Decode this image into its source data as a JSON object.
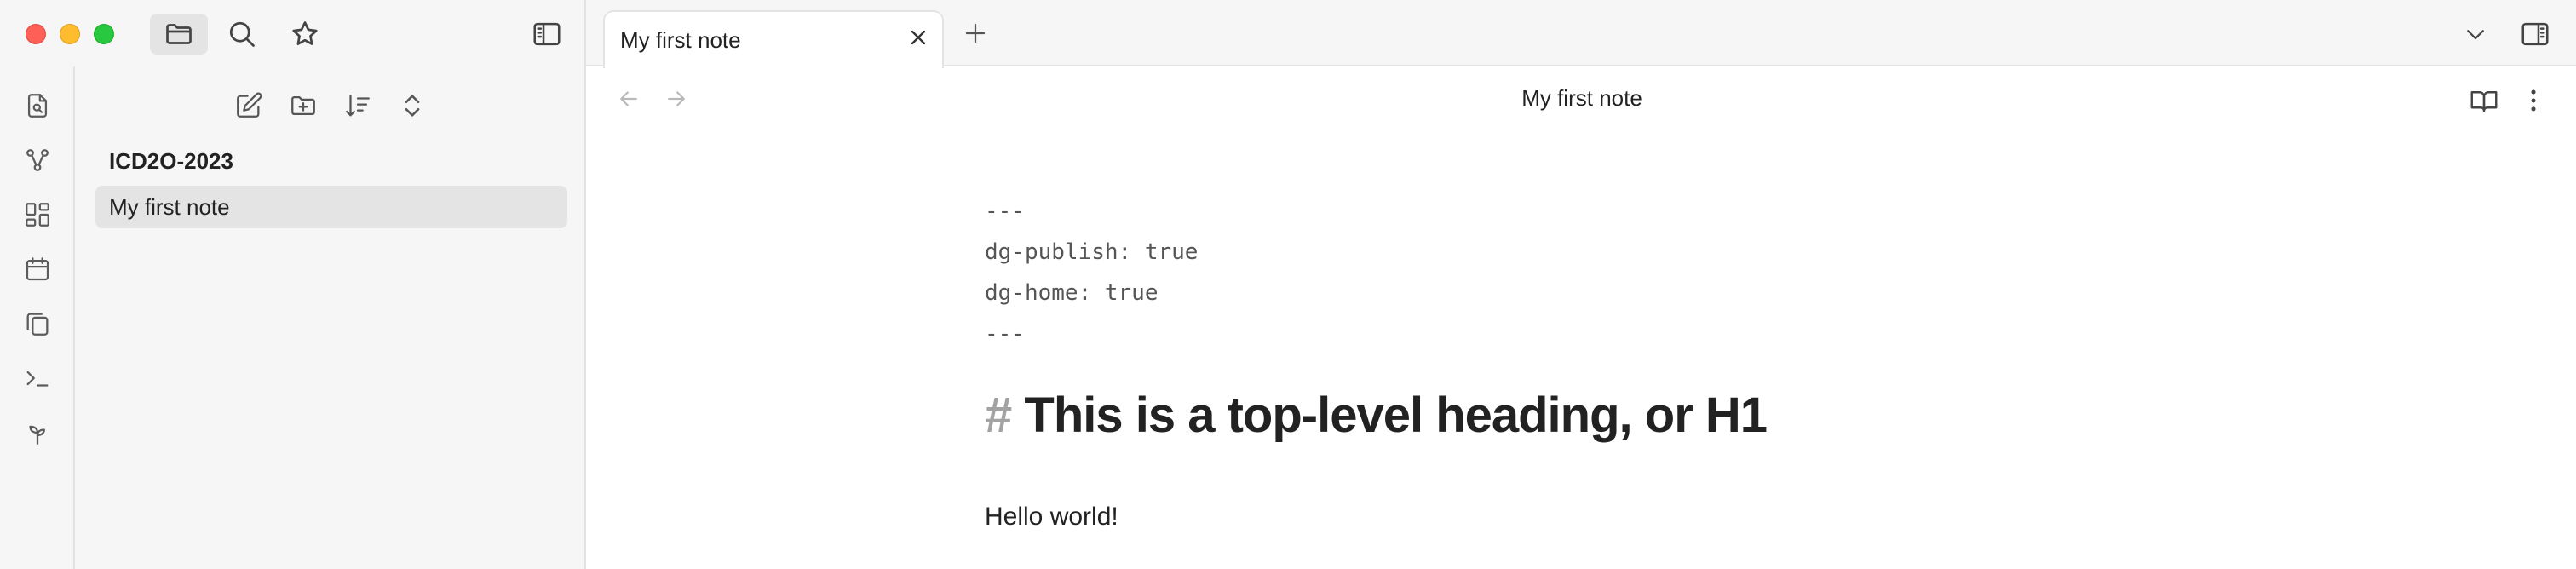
{
  "tab": {
    "title": "My first note"
  },
  "view": {
    "title": "My first note"
  },
  "explorer": {
    "vault_name": "ICD2O-2023",
    "files": [
      "My first note"
    ]
  },
  "note": {
    "frontmatter": [
      "---",
      "dg-publish: true",
      "dg-home: true",
      "---"
    ],
    "heading_marker": "#",
    "heading_text": "This is a top-level heading, or H1",
    "paragraph": "Hello world!"
  },
  "icons": {
    "titlebar": [
      "folder-icon",
      "search-icon",
      "star-icon",
      "sidebar-toggle-icon"
    ],
    "ribbon": [
      "file-search-icon",
      "graph-icon",
      "canvas-icon",
      "calendar-icon",
      "copy-icon",
      "terminal-icon",
      "sprout-icon"
    ],
    "explorer_toolbar": [
      "new-note-icon",
      "new-folder-icon",
      "sort-icon",
      "expand-collapse-icon"
    ]
  },
  "colors": {
    "close": "#fe5f57",
    "minimize": "#febc2e",
    "zoom": "#28c840",
    "active_bg": "#e4e4e4",
    "heading_marker": "#a3a3a3"
  }
}
